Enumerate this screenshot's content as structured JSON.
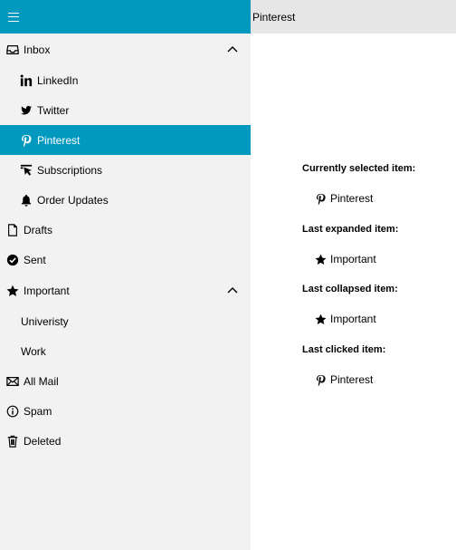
{
  "header": {
    "title": "Pinterest"
  },
  "nav": {
    "inbox": "Inbox",
    "linkedin": "LinkedIn",
    "twitter": "Twitter",
    "pinterest": "Pinterest",
    "subscriptions": "Subscriptions",
    "order_updates": "Order Updates",
    "drafts": "Drafts",
    "sent": "Sent",
    "important": "Important",
    "university": "Univeristy",
    "work": "Work",
    "all_mail": "All Mail",
    "spam": "Spam",
    "deleted": "Deleted"
  },
  "info": {
    "selected_label": "Currently selected item:",
    "selected_value": "Pinterest",
    "expanded_label": "Last expanded item:",
    "expanded_value": "Important",
    "collapsed_label": "Last collapsed item:",
    "collapsed_value": "Important",
    "clicked_label": "Last clicked item:",
    "clicked_value": "Pinterest"
  },
  "colors": {
    "accent": "#0299be",
    "pane": "#f2f2f2",
    "title_bar": "#e6e6e6"
  }
}
